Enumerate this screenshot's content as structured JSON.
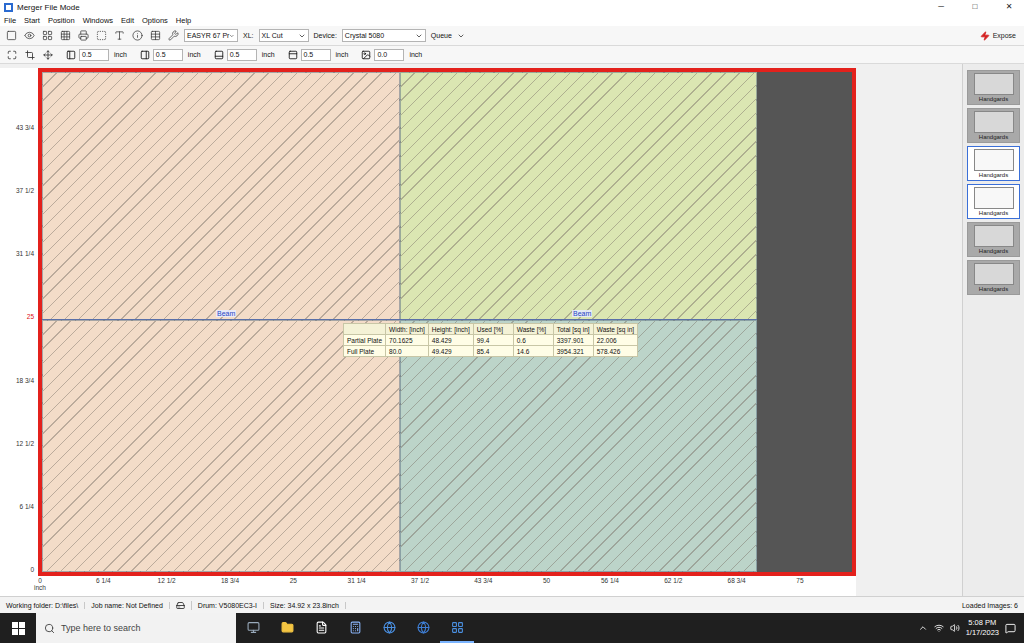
{
  "window": {
    "title": "Merger File Mode",
    "controls": [
      "─",
      "□",
      "✕"
    ]
  },
  "menu": [
    "File",
    "Start",
    "Position",
    "Windows",
    "Edit",
    "Options",
    "Help"
  ],
  "toolbar": {
    "template": "EASYR 67 Pr",
    "xl_label": "XL:",
    "xl_value": "XL Cut",
    "device_label": "Device:",
    "device": "Crystal 5080",
    "queue": "Queue",
    "expose": "Expose"
  },
  "margins": [
    {
      "value": "0.5",
      "unit": "inch"
    },
    {
      "value": "0.5",
      "unit": "inch"
    },
    {
      "value": "0.5",
      "unit": "inch"
    },
    {
      "value": "0.5",
      "unit": "inch"
    },
    {
      "value": "0.0",
      "unit": "inch"
    }
  ],
  "rulers": {
    "unit": "inch",
    "vertical": [
      {
        "label": "43 3/4",
        "marked": false
      },
      {
        "label": "37 1/2",
        "marked": false
      },
      {
        "label": "31 1/4",
        "marked": false
      },
      {
        "label": "25",
        "marked": true
      },
      {
        "label": "18 3/4",
        "marked": false
      },
      {
        "label": "12 1/2",
        "marked": false
      },
      {
        "label": "6 1/4",
        "marked": false
      },
      {
        "label": "0",
        "marked": false
      }
    ],
    "horizontal": [
      {
        "label": "0",
        "marked": false
      },
      {
        "label": "6 1/4",
        "marked": false
      },
      {
        "label": "12 1/2",
        "marked": false
      },
      {
        "label": "18 3/4",
        "marked": false
      },
      {
        "label": "25",
        "marked": false
      },
      {
        "label": "31 1/4",
        "marked": false
      },
      {
        "label": "37 1/2",
        "marked": false
      },
      {
        "label": "43 3/4",
        "marked": false
      },
      {
        "label": "50",
        "marked": false
      },
      {
        "label": "56 1/4",
        "marked": false
      },
      {
        "label": "62 1/2",
        "marked": false
      },
      {
        "label": "68 3/4",
        "marked": false
      },
      {
        "label": "75",
        "marked": false
      }
    ]
  },
  "quadrants": [
    {
      "name": "top-left",
      "color": "#f3dcc8"
    },
    {
      "name": "top-right",
      "color": "#dbe6b2"
    },
    {
      "name": "bottom-left",
      "color": "#f3dcc8"
    },
    {
      "name": "bottom-right",
      "color": "#bcd4c9"
    }
  ],
  "beam": {
    "labels": [
      "Beam",
      "Beam"
    ]
  },
  "plate_table": {
    "columns": [
      "",
      "Width: [inch]",
      "Height: [inch]",
      "Used [%]",
      "Waste [%]",
      "Total [sq in]",
      "Waste [sq in]"
    ],
    "rows": [
      [
        "Partial Plate",
        "70.1625",
        "48.429",
        "99.4",
        "0.6",
        "3397.901",
        "22.006"
      ],
      [
        "Full Plate",
        "80.0",
        "49.429",
        "85.4",
        "14.6",
        "3954.321",
        "578.426"
      ]
    ]
  },
  "thumbnails": [
    {
      "label": "Handgards",
      "selected": false
    },
    {
      "label": "Handgards",
      "selected": false
    },
    {
      "label": "Handgards",
      "selected": true
    },
    {
      "label": "Handgards",
      "selected": true
    },
    {
      "label": "Handgards",
      "selected": false
    },
    {
      "label": "Handgards",
      "selected": false
    }
  ],
  "status_bar": {
    "working_folder": "Working folder: D:\\files\\",
    "job": "Job name: Not Defined",
    "drum": "Drum: V5080EC3-I",
    "size": "Size: 34.92 x 23.8inch",
    "loaded": "Loaded Images: 6"
  },
  "taskbar": {
    "search_placeholder": "Type here to search",
    "time": "5:08 PM",
    "date": "1/17/2023"
  }
}
